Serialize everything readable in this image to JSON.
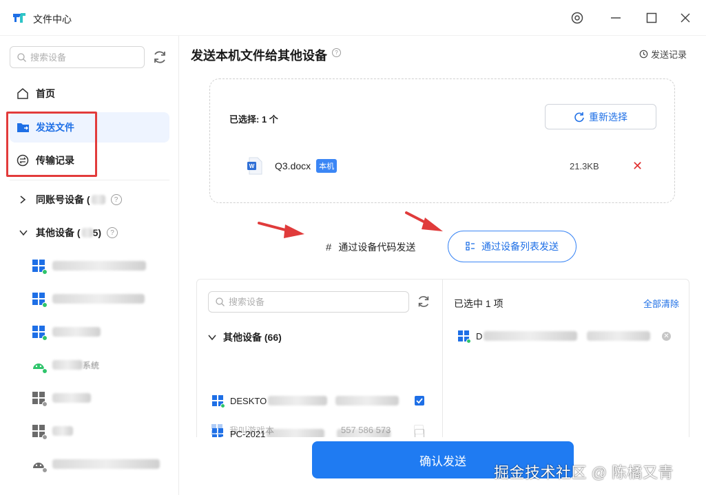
{
  "window": {
    "title": "文件中心",
    "controls": [
      "settings-icon",
      "minimize-icon",
      "maximize-icon",
      "close-icon"
    ]
  },
  "sidebar": {
    "search_placeholder": "搜索设备",
    "nav": [
      {
        "label": "首页",
        "icon": "home-icon",
        "active": false
      },
      {
        "label": "发送文件",
        "icon": "send-folder-icon",
        "active": true
      },
      {
        "label": "传输记录",
        "icon": "transfer-icon",
        "active": false
      }
    ],
    "groups": [
      {
        "label": "同账号设备 (",
        "expanded": false
      },
      {
        "label": "其他设备 (",
        "count_visible": "5)",
        "expanded": true
      }
    ],
    "devices": [
      {
        "os": "windows",
        "online": true
      },
      {
        "os": "windows",
        "online": true
      },
      {
        "os": "windows",
        "online": true
      },
      {
        "os": "android",
        "online": true,
        "suffix": "系统"
      },
      {
        "os": "windows",
        "online": false
      },
      {
        "os": "windows",
        "online": false
      },
      {
        "os": "android",
        "online": false
      }
    ],
    "colors": {
      "active_bg": "#eef4ff",
      "accent": "#1e6fe6",
      "highlight_border": "#e23b3b",
      "online": "#2ec46b",
      "offline": "#9a9a9a"
    }
  },
  "main": {
    "title": "发送本机文件给其他设备",
    "history_label": "发送记录",
    "selection": {
      "count_label": "已选择: 1 个",
      "reselect_label": "重新选择",
      "file": {
        "name": "Q3.docx",
        "badge": "本机",
        "size": "21.3KB"
      }
    },
    "modes": {
      "by_code": "通过设备代码发送",
      "by_list": "通过设备列表发送",
      "active": "by_list"
    },
    "device_panel": {
      "search_placeholder": "搜索设备",
      "group_label": "其他设备 (66)",
      "devices": [
        {
          "name": "DESKTO",
          "checked": true
        },
        {
          "name": "PC-2021",
          "checked": false
        },
        {
          "name": "我叫游戏本",
          "extra": "557 586 573",
          "checked": false
        }
      ]
    },
    "selected_panel": {
      "label": "已选中 1 项",
      "clear_label": "全部清除",
      "items": [
        {
          "name": "D"
        }
      ]
    },
    "confirm_label": "确认发送"
  },
  "watermark": "掘金技术社区 @ 陈橘又青"
}
